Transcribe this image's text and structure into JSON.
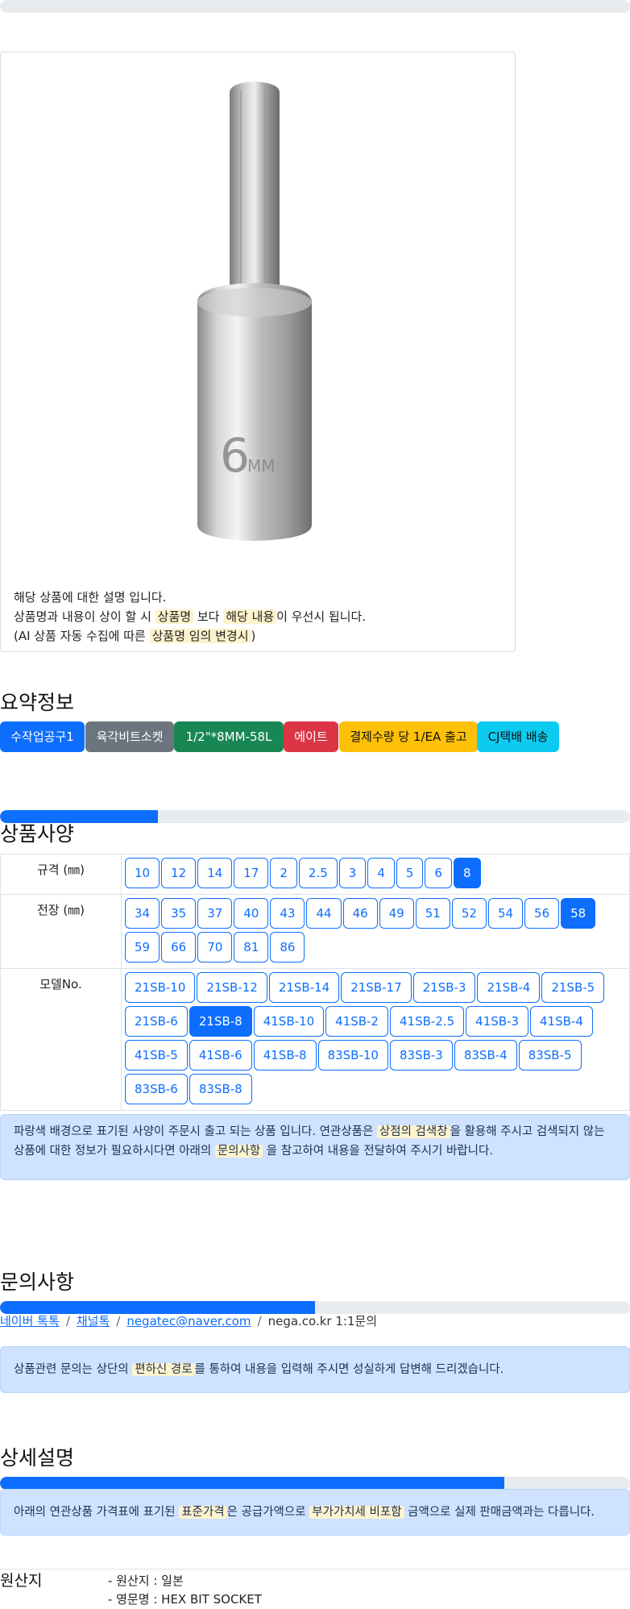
{
  "product_image": {
    "alt": "hex bit socket 6mm",
    "engraving": "6"
  },
  "description": {
    "line1": "해당 상품에 대한 설명 입니다.",
    "line2_a": "상품명과 내용이 상이 할 시 ",
    "line2_hl1": "상품명",
    "line2_b": " 보다 ",
    "line2_hl2": "해당 내용",
    "line2_c": "이 우선시 됩니다.",
    "line3_a": "(AI 상품 자동 수집에 따른 ",
    "line3_hl": "상품명 임의 변경시",
    "line3_b": ")"
  },
  "summary": {
    "title": "요약정보",
    "badges": [
      {
        "label": "수작업공구1",
        "color": "#0d6efd"
      },
      {
        "label": "육각비트소켓",
        "color": "#6c757d"
      },
      {
        "label": "1/2\"*8MM-58L",
        "color": "#198754"
      },
      {
        "label": "에이트",
        "color": "#dc3545"
      },
      {
        "label": "결제수량 당 1/EA 출고",
        "color": "#ffc107"
      },
      {
        "label": "CJ택배 배송",
        "color": "#0dcaf0"
      }
    ]
  },
  "spec": {
    "progress": 0.25,
    "title": "상품사양",
    "rows": [
      {
        "label": "규격 (㎜)",
        "options": [
          "10",
          "12",
          "14",
          "17",
          "2",
          "2.5",
          "3",
          "4",
          "5",
          "6",
          "8"
        ],
        "selected": "8"
      },
      {
        "label": "전장 (㎜)",
        "options": [
          "34",
          "35",
          "37",
          "40",
          "43",
          "44",
          "46",
          "49",
          "51",
          "52",
          "54",
          "56",
          "58",
          "59",
          "66",
          "70",
          "81",
          "86"
        ],
        "selected": "58"
      },
      {
        "label": "모델No.",
        "options": [
          "21SB-10",
          "21SB-12",
          "21SB-14",
          "21SB-17",
          "21SB-3",
          "21SB-4",
          "21SB-5",
          "21SB-6",
          "21SB-8",
          "41SB-10",
          "41SB-2",
          "41SB-2.5",
          "41SB-3",
          "41SB-4",
          "41SB-5",
          "41SB-6",
          "41SB-8",
          "83SB-10",
          "83SB-3",
          "83SB-4",
          "83SB-5",
          "83SB-6",
          "83SB-8"
        ],
        "selected": "21SB-8"
      }
    ],
    "notice_a": "파랑색 배경으로 표기된 사양이 주문시 출고 되는 상품 입니다. 연관상품은 ",
    "notice_hl1": "상점의 검색창",
    "notice_b": "을 활용해 주시고 검색되지 않는 상품에 대한 정보가 필요하시다면 아래의 ",
    "notice_hl2": "문의사항",
    "notice_c": " 을 참고하여 내용을 전달하여 주시기 바랍니다."
  },
  "inquiry": {
    "title": "문의사항",
    "progress": 0.5,
    "links": [
      "네이버 톡톡",
      "채널톡",
      "negatec@naver.com"
    ],
    "plain": "nega.co.kr 1:1문의",
    "separator": "/",
    "notice_a": "상품관련 문의는 상단의 ",
    "notice_hl": "편하신 경로",
    "notice_b": "를 통하여 내용을 입력해 주시면 성실하게 답변해 드리겠습니다."
  },
  "detail": {
    "title": "상세설명",
    "progress": 0.8,
    "notice_a": "아래의 연관상품 가격표에 표기된 ",
    "notice_hl1": "표준가격",
    "notice_b": "은 공급가액으로 ",
    "notice_hl2": "부가가치세 비포함",
    "notice_c": " 금액으로 실제 판매금액과는 다릅니다."
  },
  "origin": {
    "label": "원산지",
    "items": [
      "- 원산지 : 일본",
      "- 영문명 : HEX BIT SOCKET"
    ]
  }
}
